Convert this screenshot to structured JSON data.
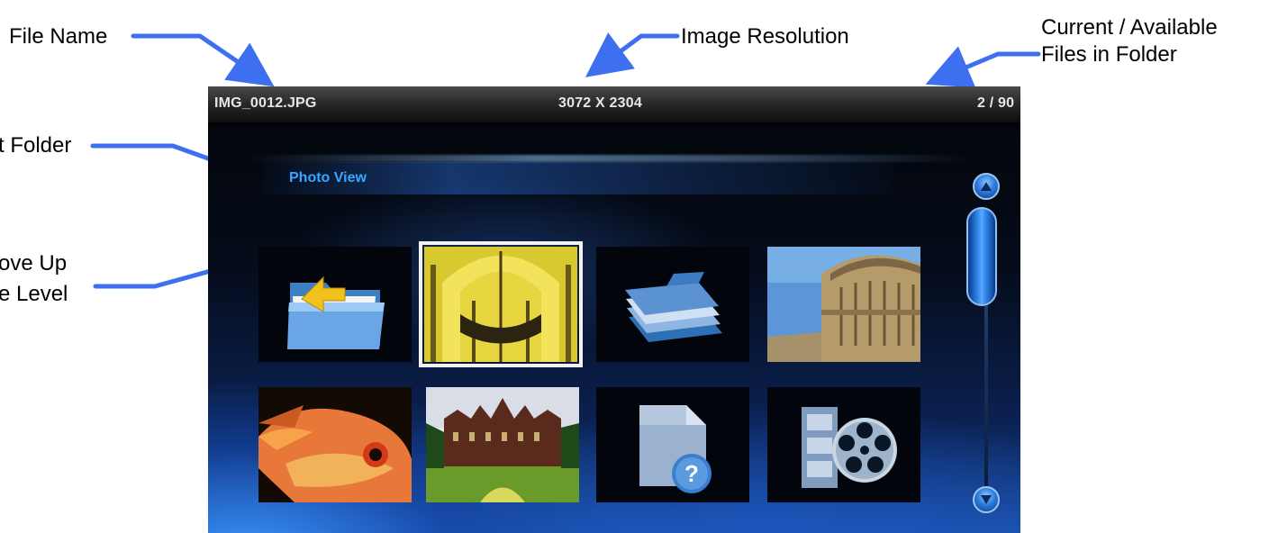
{
  "callouts": {
    "file_name": "File Name",
    "image_resolution": "Image Resolution",
    "files_in_folder_line1": "Current / Available",
    "files_in_folder_line2": "Files in Folder",
    "current_folder": "t Folder",
    "move_up_line1": "ove Up",
    "move_up_line2": "e Level"
  },
  "topbar": {
    "file_name": "IMG_0012.JPG",
    "resolution": "3072 X 2304",
    "file_counter": "2 / 90"
  },
  "folder": {
    "title": "Photo View"
  },
  "grid": [
    {
      "name": "folder-up-tile",
      "icon": "folder-up-icon",
      "selected": false
    },
    {
      "name": "cathedral-interior-photo",
      "icon": "photo-thumbnail",
      "selected": true
    },
    {
      "name": "folder-tile",
      "icon": "stacked-folder-icon",
      "selected": false
    },
    {
      "name": "rotunda-building-photo",
      "icon": "photo-thumbnail",
      "selected": false
    },
    {
      "name": "red-fish-photo",
      "icon": "photo-thumbnail",
      "selected": false
    },
    {
      "name": "castle-photo",
      "icon": "photo-thumbnail",
      "selected": false
    },
    {
      "name": "unknown-file-tile",
      "icon": "unknown-file-icon",
      "selected": false
    },
    {
      "name": "video-file-tile",
      "icon": "film-reel-icon",
      "selected": false
    }
  ],
  "scrollbar": {
    "up_icon": "chevron-up-icon",
    "down_icon": "chevron-down-icon"
  },
  "colors": {
    "arrow": "#3d6ff0",
    "folder_title": "#35a8ff",
    "selection": "#f2f2f2"
  }
}
